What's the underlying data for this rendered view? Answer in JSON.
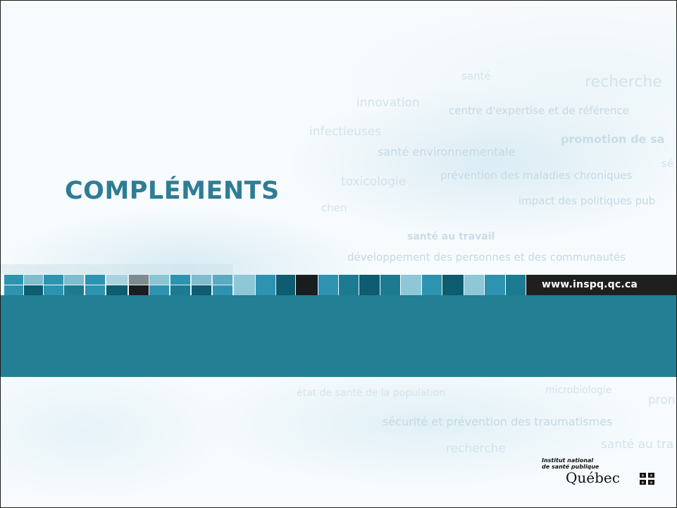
{
  "slide": {
    "title": "COMPLÉMENTS",
    "url": "www.inspq.qc.ca",
    "background_words": [
      "santé",
      "recherche",
      "innovation",
      "centre d'expertise et de référence",
      "infectieuses",
      "promotion de sa",
      "santé environnementale",
      "sé",
      "toxicologie",
      "prévention des maladies chroniques",
      "impact des politiques pub",
      "chen",
      "santé au travail",
      "développement des personnes et des communautés",
      "état de santé de la population",
      "microbiologie",
      "pron",
      "sécurité et prévention des traumatismes",
      "recherche",
      "santé au tra"
    ]
  },
  "logo": {
    "line1": "Institut national",
    "line2": "de santé publique",
    "wordmark": "Québec"
  },
  "colors": {
    "title": "#2e7d94",
    "band": "#237f93",
    "url_bar": "#1f1f1f"
  }
}
